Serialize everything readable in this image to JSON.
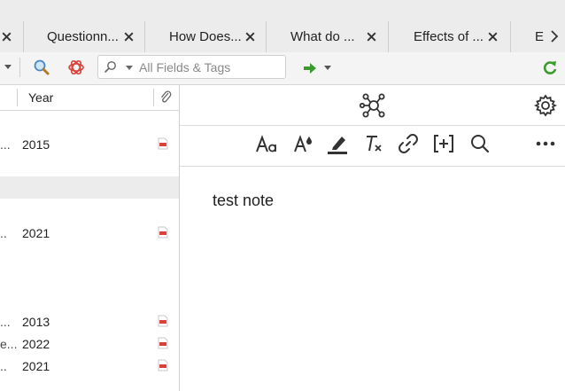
{
  "tabs": [
    {
      "label": "Questionn..."
    },
    {
      "label": "How Does..."
    },
    {
      "label": "What do ..."
    },
    {
      "label": "Effects of ..."
    },
    {
      "label": "E"
    }
  ],
  "toolbar": {
    "search_placeholder": "All Fields & Tags"
  },
  "items": {
    "column_header": "Year",
    "rows": [
      {
        "trunc": "...",
        "year": "2015",
        "has_pdf": true
      },
      {
        "trunc": "..",
        "year": "2021",
        "has_pdf": true
      },
      {
        "trunc": "...",
        "year": "2013",
        "has_pdf": true
      },
      {
        "trunc": "e...",
        "year": "2022",
        "has_pdf": true
      },
      {
        "trunc": "..",
        "year": "2021",
        "has_pdf": true
      }
    ]
  },
  "note": {
    "text": "test note"
  },
  "icons": {
    "tab_close": "close-icon",
    "tab_scroll": "chevron-right-icon",
    "lookup": "magnifier-icon",
    "assistant": "openai-icon",
    "locate": "arrow-right-icon",
    "sync": "sync-icon",
    "related": "graph-icon",
    "settings": "gear-icon",
    "font": "font-size-icon",
    "text_color": "text-color-icon",
    "highlight": "highlighter-icon",
    "clear_format": "clear-formatting-icon",
    "link": "link-icon",
    "citation": "insert-citation-icon",
    "find": "search-icon",
    "more": "more-icon"
  },
  "colors": {
    "accent_green": "#3a9c2e",
    "pdf_red": "#d9423a",
    "selected_row": "#ececec"
  }
}
